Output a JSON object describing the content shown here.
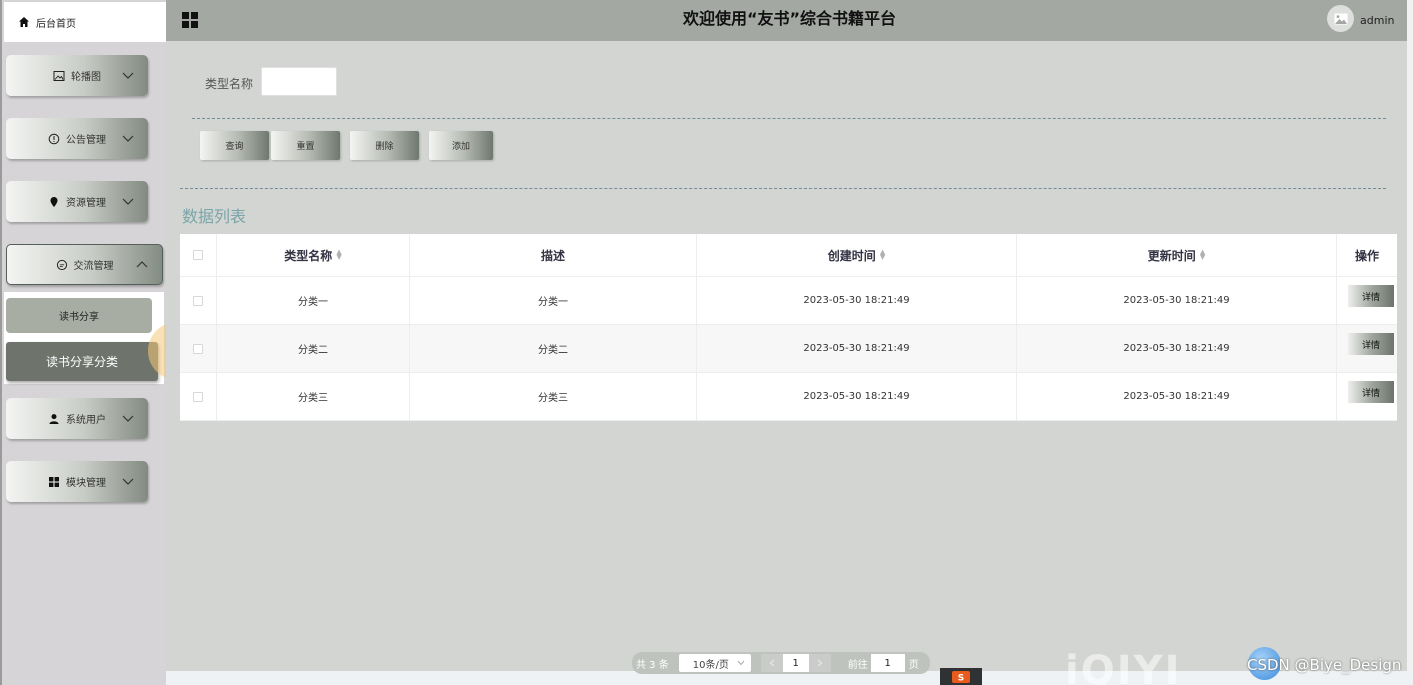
{
  "header": {
    "title": "欢迎使用“友书”综合书籍平台",
    "username": "admin"
  },
  "sidebar": {
    "home_label": "后台首页",
    "items": [
      {
        "label": "轮播图",
        "icon": "image-icon"
      },
      {
        "label": "公告管理",
        "icon": "info-icon"
      },
      {
        "label": "资源管理",
        "icon": "pin-icon"
      },
      {
        "label": "交流管理",
        "icon": "chat-icon"
      },
      {
        "label": "系统用户",
        "icon": "user-icon"
      },
      {
        "label": "模块管理",
        "icon": "grid-icon"
      }
    ],
    "submenu": [
      "读书分享",
      "读书分享分类"
    ]
  },
  "filter": {
    "label": "类型名称",
    "value": ""
  },
  "buttons": {
    "query": "查询",
    "reset": "重置",
    "delete": "删除",
    "add": "添加"
  },
  "section_title": "数据列表",
  "table": {
    "columns": [
      "类型名称",
      "描述",
      "创建时间",
      "更新时间",
      "操作"
    ],
    "rows": [
      {
        "name": "分类一",
        "desc": "分类一",
        "created": "2023-05-30 18:21:49",
        "updated": "2023-05-30 18:21:49",
        "action": "详情"
      },
      {
        "name": "分类二",
        "desc": "分类二",
        "created": "2023-05-30 18:21:49",
        "updated": "2023-05-30 18:21:49",
        "action": "详情"
      },
      {
        "name": "分类三",
        "desc": "分类三",
        "created": "2023-05-30 18:21:49",
        "updated": "2023-05-30 18:21:49",
        "action": "详情"
      }
    ]
  },
  "pagination": {
    "total": "共 3 条",
    "page_size": "10条/页",
    "current": "1",
    "goto_label": "前往",
    "goto_value": "1",
    "page_suffix": "页"
  },
  "watermark": {
    "csdn": "CSDN @Biye_Design",
    "iqiyi": "iQIYI"
  },
  "colors": {
    "header_bg": "#a4a8a3",
    "main_bg": "#d2d5d1",
    "sidebar_bg": "#d6d4d6",
    "accent_text": "#7aa5aa",
    "active_submenu": "#6e736c"
  }
}
